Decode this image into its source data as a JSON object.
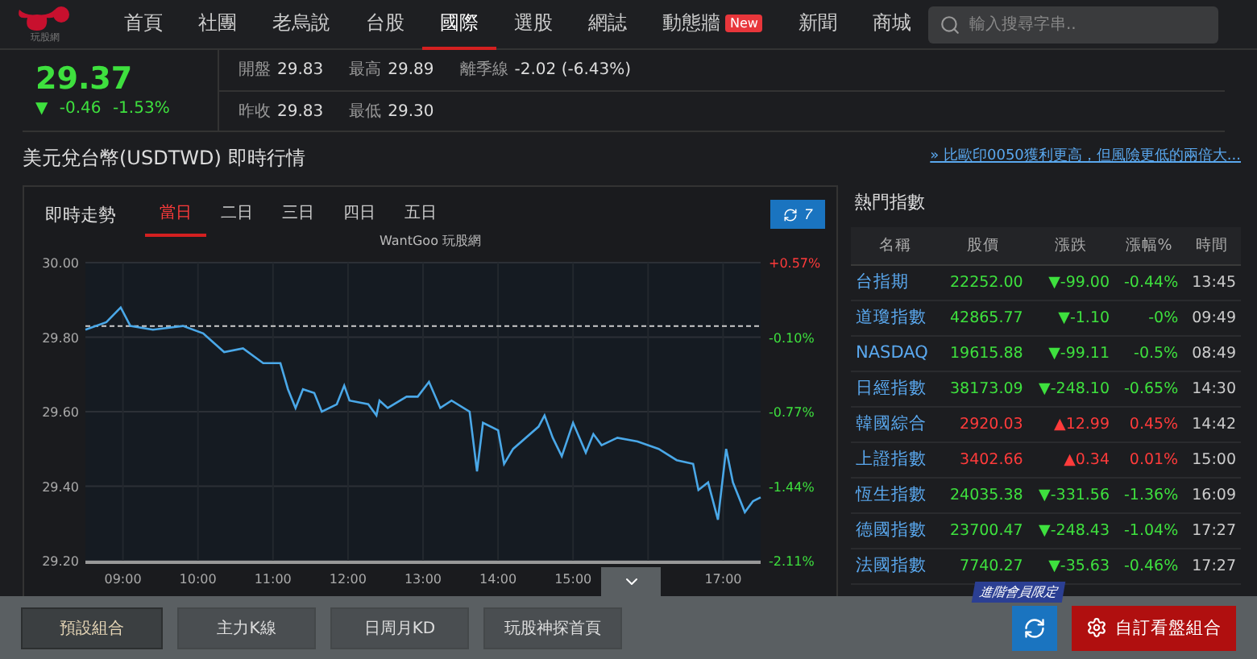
{
  "nav": {
    "logo_text": "玩股網",
    "items": [
      {
        "label": "首頁",
        "selected": false
      },
      {
        "label": "社團",
        "selected": false
      },
      {
        "label": "老烏說",
        "selected": false
      },
      {
        "label": "台股",
        "selected": false
      },
      {
        "label": "國際",
        "selected": true
      },
      {
        "label": "選股",
        "selected": false
      },
      {
        "label": "網誌",
        "selected": false
      },
      {
        "label": "動態牆",
        "selected": false,
        "badge": "New"
      },
      {
        "label": "新聞",
        "selected": false
      },
      {
        "label": "商城",
        "selected": false
      }
    ],
    "search": {
      "placeholder": "輸入搜尋字串.."
    }
  },
  "quote": {
    "price": "29.37",
    "up": false,
    "arrow": "▼",
    "change": "-0.46",
    "change_pct": "-1.53%",
    "stats": [
      [
        {
          "label": "開盤",
          "value": "29.83"
        },
        {
          "label": "最高",
          "value": "29.89"
        },
        {
          "label": "離季線",
          "value": "-2.02 (-6.43%)"
        }
      ],
      [
        {
          "label": "昨收",
          "value": "29.83"
        },
        {
          "label": "最低",
          "value": "29.30"
        }
      ]
    ]
  },
  "title": "美元兌台幣(USDTWD) 即時行情",
  "promo_link": "» 比歐印0050獲利更高，但風險更低的兩倍大...",
  "chart_panel": {
    "label": "即時走勢",
    "refresh_count": "7",
    "tabs": [
      {
        "label": "當日",
        "selected": true
      },
      {
        "label": "二日",
        "selected": false
      },
      {
        "label": "三日",
        "selected": false
      },
      {
        "label": "四日",
        "selected": false
      },
      {
        "label": "五日",
        "selected": false
      }
    ],
    "right_axis_labels": [
      {
        "text": "+0.57%",
        "up": true
      },
      {
        "text": "-0.10%",
        "up": false
      },
      {
        "text": "-0.77%",
        "up": false
      },
      {
        "text": "-1.44%",
        "up": false
      },
      {
        "text": "-2.11%",
        "up": false
      }
    ],
    "chart_data": {
      "type": "line",
      "title": "WantGoo 玩股網",
      "x": [
        8.5,
        8.78,
        8.97,
        9.1,
        9.4,
        9.8,
        10.07,
        10.35,
        10.6,
        10.87,
        11.1,
        11.2,
        11.3,
        11.4,
        11.55,
        11.65,
        11.85,
        11.95,
        12.02,
        12.27,
        12.38,
        12.42,
        12.53,
        12.78,
        12.93,
        13.08,
        13.23,
        13.38,
        13.62,
        13.72,
        13.8,
        14.0,
        14.08,
        14.2,
        14.54,
        14.62,
        14.73,
        14.85,
        15.0,
        15.17,
        15.27,
        15.38,
        15.59,
        15.86,
        16.14,
        16.38,
        16.6,
        16.67,
        16.8,
        16.93,
        17.04,
        17.13,
        17.29,
        17.4,
        17.5
      ],
      "series": [
        {
          "color": "#4aa8e8",
          "values": [
            29.82,
            29.84,
            29.88,
            29.83,
            29.82,
            29.83,
            29.81,
            29.76,
            29.77,
            29.73,
            29.73,
            29.66,
            29.61,
            29.66,
            29.65,
            29.6,
            29.62,
            29.67,
            29.63,
            29.62,
            29.59,
            29.63,
            29.61,
            29.64,
            29.64,
            29.68,
            29.61,
            29.63,
            29.6,
            29.44,
            29.57,
            29.55,
            29.46,
            29.5,
            29.56,
            29.59,
            29.53,
            29.48,
            29.57,
            29.49,
            29.54,
            29.51,
            29.53,
            29.52,
            29.5,
            29.47,
            29.46,
            29.39,
            29.41,
            29.31,
            29.5,
            29.41,
            29.33,
            29.36,
            29.37
          ]
        }
      ],
      "xlim": [
        8.5,
        17.5
      ],
      "ylim": [
        29.2,
        30.0
      ],
      "grid": true,
      "xticks": [
        {
          "value": 9,
          "label": "09:00"
        },
        {
          "value": 10,
          "label": "10:00"
        },
        {
          "value": 11,
          "label": "11:00"
        },
        {
          "value": 12,
          "label": "12:00"
        },
        {
          "value": 13,
          "label": "13:00"
        },
        {
          "value": 14,
          "label": "14:00"
        },
        {
          "value": 15,
          "label": "15:00"
        },
        {
          "value": 17,
          "label": "17:00"
        }
      ],
      "yticks": [
        {
          "value": 30,
          "label": "30.00"
        },
        {
          "value": 29.8,
          "label": "29.80"
        },
        {
          "value": 29.6,
          "label": "29.60"
        },
        {
          "value": 29.4,
          "label": "29.40"
        },
        {
          "value": 29.2,
          "label": "29.20"
        }
      ],
      "ref_lines": [
        {
          "axis": "y",
          "value": 29.83
        }
      ]
    }
  },
  "hot_indices": {
    "title": "熱門指數",
    "columns": [
      "名稱",
      "股價",
      "漲跌",
      "漲幅%",
      "時間"
    ],
    "rows": [
      {
        "name": "台指期",
        "price": "22252.00",
        "up": false,
        "change": "▼-99.00",
        "pct": "-0.44%",
        "time": "13:45"
      },
      {
        "name": "道瓊指數",
        "price": "42865.77",
        "up": false,
        "change": "▼-1.10",
        "pct": "-0%",
        "time": "09:49"
      },
      {
        "name": "NASDAQ",
        "price": "19615.88",
        "up": false,
        "change": "▼-99.11",
        "pct": "-0.5%",
        "time": "08:49"
      },
      {
        "name": "日經指數",
        "price": "38173.09",
        "up": false,
        "change": "▼-248.10",
        "pct": "-0.65%",
        "time": "14:30"
      },
      {
        "name": "韓國綜合",
        "price": "2920.03",
        "up": true,
        "change": "▲12.99",
        "pct": "0.45%",
        "time": "14:42"
      },
      {
        "name": "上證指數",
        "price": "3402.66",
        "up": true,
        "change": "▲0.34",
        "pct": "0.01%",
        "time": "15:00"
      },
      {
        "name": "恆生指數",
        "price": "24035.38",
        "up": false,
        "change": "▼-331.56",
        "pct": "-1.36%",
        "time": "16:09"
      },
      {
        "name": "德國指數",
        "price": "23700.47",
        "up": false,
        "change": "▼-248.43",
        "pct": "-1.04%",
        "time": "17:27"
      },
      {
        "name": "法國指數",
        "price": "7740.27",
        "up": false,
        "change": "▼-35.63",
        "pct": "-0.46%",
        "time": "17:27"
      }
    ]
  },
  "bottom_bar": {
    "expanded": true,
    "presets": [
      {
        "label": "預設組合",
        "selected": true
      },
      {
        "label": "主力K線",
        "selected": false
      },
      {
        "label": "日周月KD",
        "selected": false
      },
      {
        "label": "玩股神探首頁",
        "selected": false
      }
    ],
    "tooltip": "進階會員限定",
    "custom_button": "自訂看盤組合"
  }
}
